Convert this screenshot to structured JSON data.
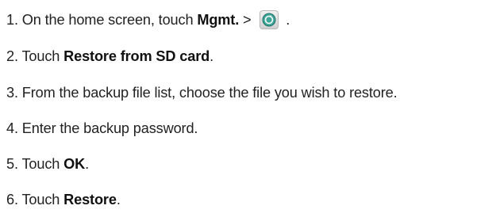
{
  "steps": [
    {
      "num": "1. ",
      "pre": "On the home screen, touch ",
      "bold": "Mgmt.",
      "post": " > ",
      "icon": "backup-restore-app-icon",
      "tail": " ."
    },
    {
      "num": "2. ",
      "pre": "Touch ",
      "bold": "Restore from SD card",
      "post": "."
    },
    {
      "num": "3. ",
      "pre": "From the backup file list, choose the file you wish to restore."
    },
    {
      "num": "4. ",
      "pre": "Enter the backup password."
    },
    {
      "num": "5. ",
      "pre": "Touch ",
      "bold": "OK",
      "post": "."
    },
    {
      "num": "6. ",
      "pre": "Touch ",
      "bold": "Restore",
      "post": "."
    }
  ]
}
